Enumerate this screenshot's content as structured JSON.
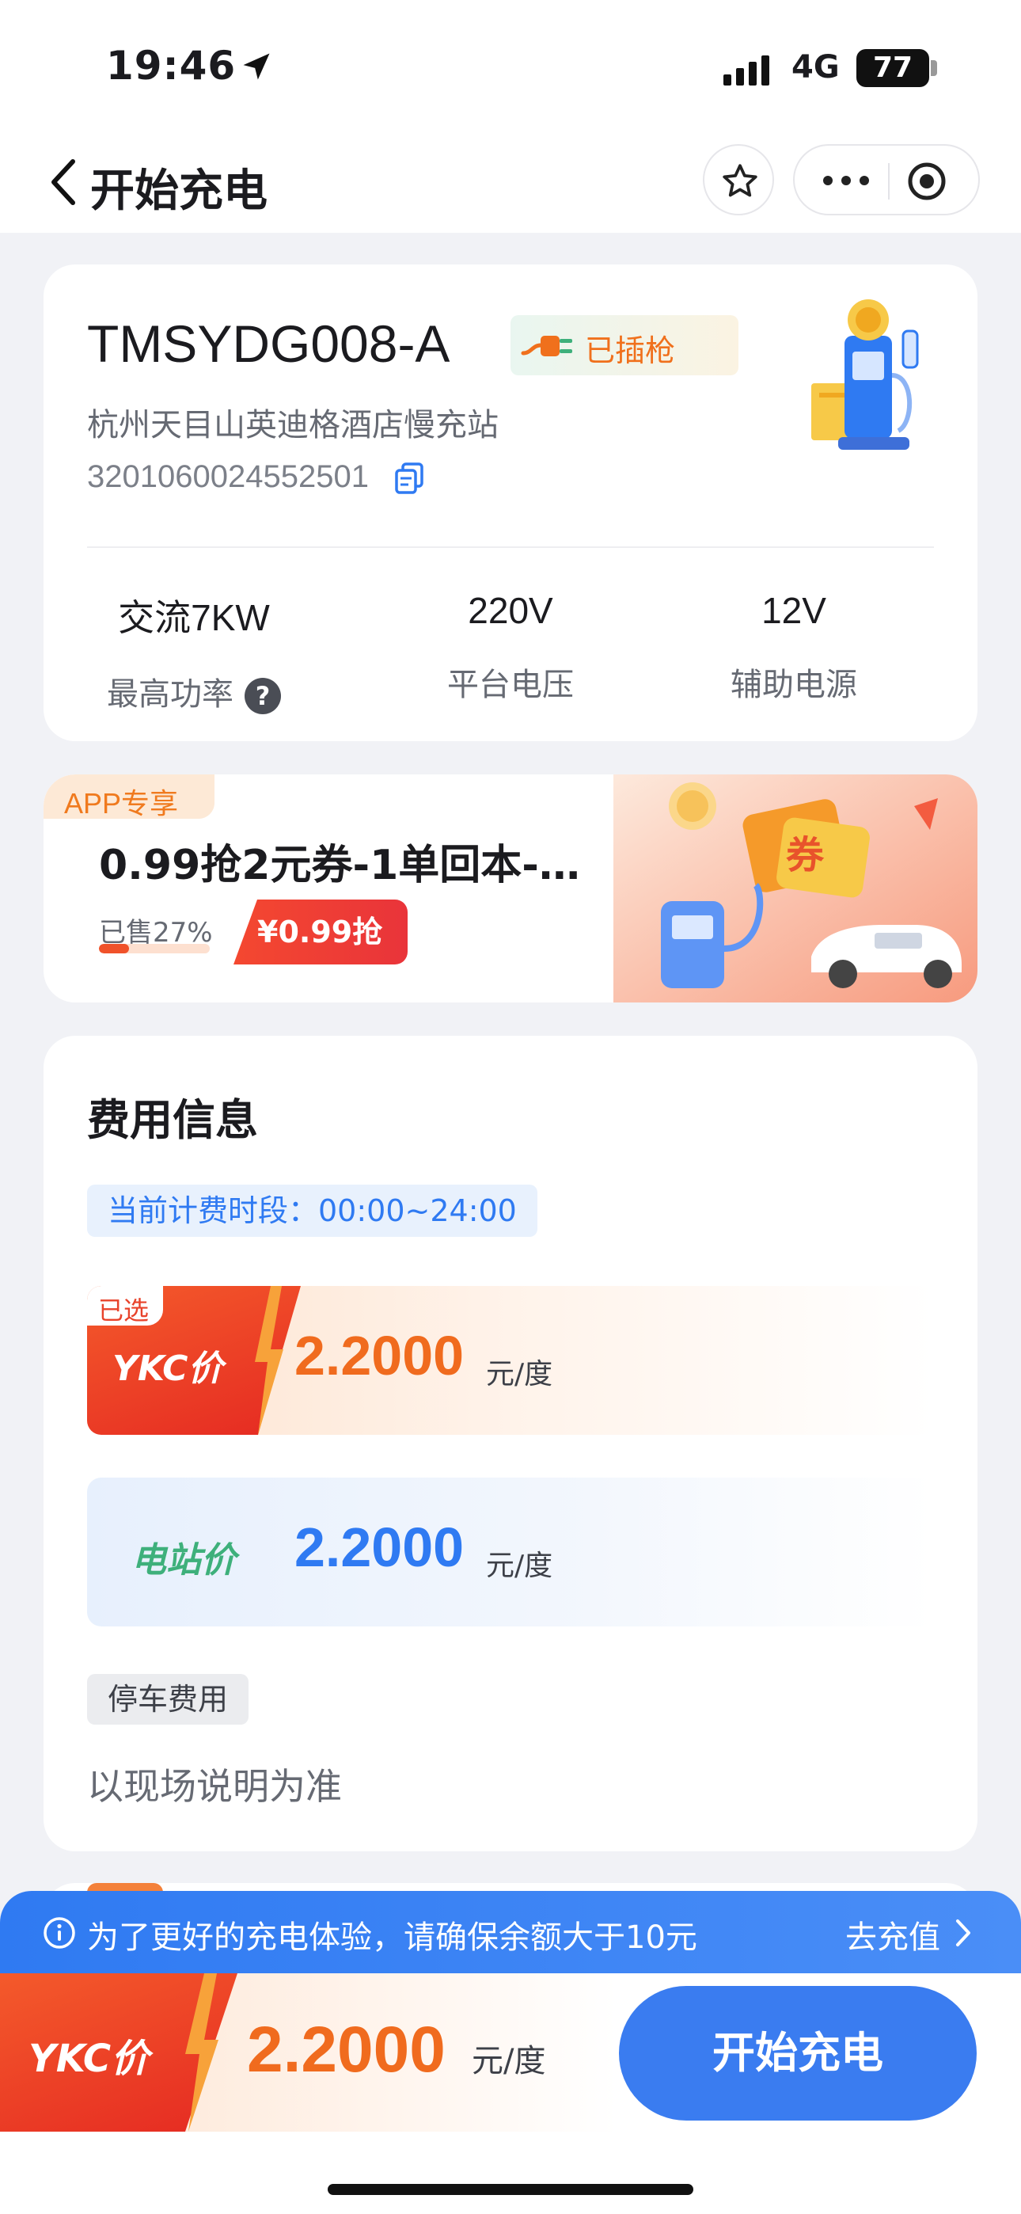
{
  "status_bar": {
    "time": "19:46",
    "network": "4G",
    "battery": "77"
  },
  "nav": {
    "title": "开始充电",
    "back_icon": "chevron-left-icon",
    "star_icon": "star-icon",
    "more_icon": "more-dots-icon",
    "target_icon": "target-icon"
  },
  "station": {
    "code": "TMSYDG008-A",
    "badge": "已插枪",
    "name": "杭州天目山英迪格酒店慢充站",
    "id": "3201060024552501",
    "specs": [
      {
        "value": "交流7KW",
        "label": "最高功率",
        "help": "?"
      },
      {
        "value": "220V",
        "label": "平台电压"
      },
      {
        "value": "12V",
        "label": "辅助电源"
      }
    ]
  },
  "promo": {
    "tag": "APP专享",
    "title": "0.99抢2元券-1单回本-…",
    "sold": "已售27%",
    "sold_fraction": 0.27,
    "button": "¥0.99抢"
  },
  "fee": {
    "title": "费用信息",
    "period": "当前计费时段：00:00~24:00",
    "selected_tag": "已选",
    "ykc_label": "YKC价",
    "ykc_price": "2.2000",
    "unit": "元/度",
    "station_label": "电站价",
    "station_price": "2.2000",
    "parking_label": "停车费用",
    "parking_note": "以现场说明为准"
  },
  "notice": {
    "text": "为了更好的充电体验，请确保余额大于10元",
    "link": "去充值"
  },
  "bottom": {
    "ykc_label": "YKC价",
    "price": "2.2000",
    "unit": "元/度",
    "button": "开始充电"
  },
  "colors": {
    "accent_blue": "#2f7af2",
    "accent_orange": "#f06b1e",
    "ykc_red": "#e52a22",
    "station_green": "#3eb07b"
  }
}
